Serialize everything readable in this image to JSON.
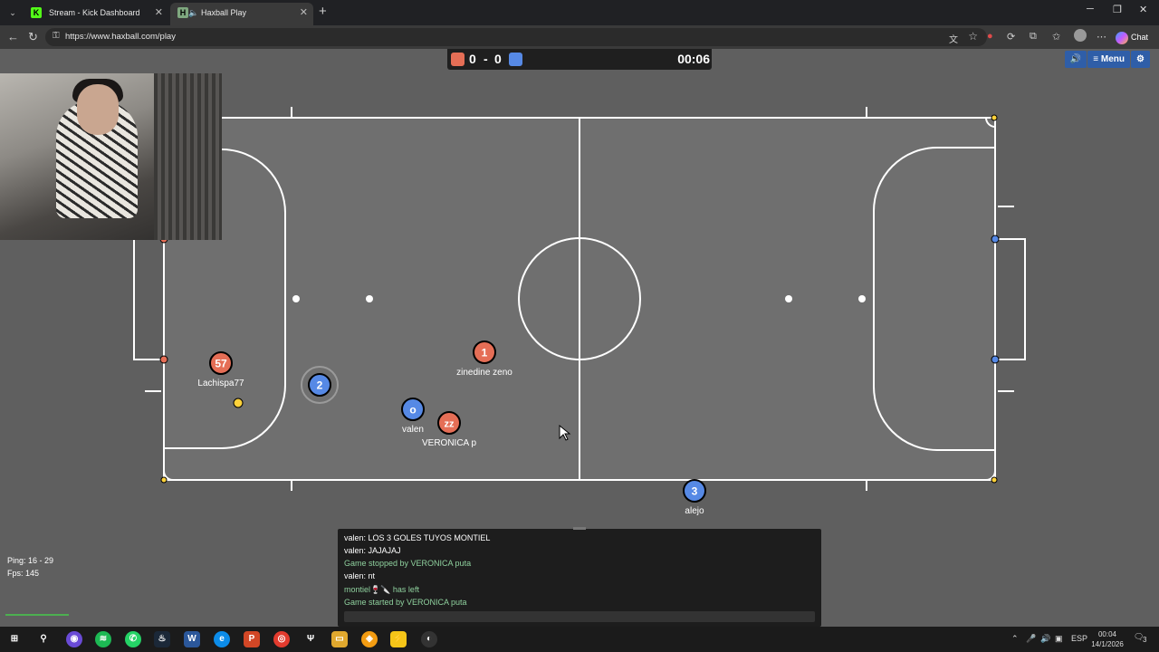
{
  "browser": {
    "tabs": [
      {
        "label": "Stream - Kick Dashboard",
        "favicon": "K"
      },
      {
        "label": "Haxball Play",
        "favicon": "H"
      }
    ],
    "url": "https://www.haxball.com/play",
    "chat_label": "Chat"
  },
  "scoreboard": {
    "red_score": "0",
    "separator": "-",
    "blue_score": "0",
    "time": "00:06",
    "colors": {
      "red": "#e56e56",
      "blue": "#5689e5"
    }
  },
  "game_menu": {
    "sound_icon": "speaker-icon",
    "menu_label": "≡ Menu",
    "settings_icon": "gear-icon"
  },
  "players": [
    {
      "avatar": "57",
      "name": "Lachispa77",
      "team": "red"
    },
    {
      "avatar": "2",
      "name": "",
      "team": "blue"
    },
    {
      "avatar": "1",
      "name": "zinedine zeno",
      "team": "red"
    },
    {
      "avatar": "o",
      "name": "valen",
      "team": "blue"
    },
    {
      "avatar": "zz",
      "name": "VERONICA p",
      "team": "red"
    },
    {
      "avatar": "3",
      "name": "alejo",
      "team": "blue"
    }
  ],
  "stats": {
    "ping": "Ping: 16 - 29",
    "fps": "Fps: 145"
  },
  "chat": {
    "messages": [
      {
        "text": "valen: LOS 3 GOLES TUYOS MONTIEL",
        "kind": "message"
      },
      {
        "text": "valen: JAJAJAJ",
        "kind": "message"
      },
      {
        "text": "Game stopped by VERONICA puta",
        "kind": "notice"
      },
      {
        "text": "valen: nt",
        "kind": "message"
      },
      {
        "text": "montiel🍷🔪 has left",
        "kind": "notice"
      },
      {
        "text": "Game started by VERONICA puta",
        "kind": "notice"
      }
    ]
  },
  "taskbar": {
    "lang": "ESP",
    "time": "00:04",
    "date": "14/1/2026",
    "notifications": "3"
  }
}
